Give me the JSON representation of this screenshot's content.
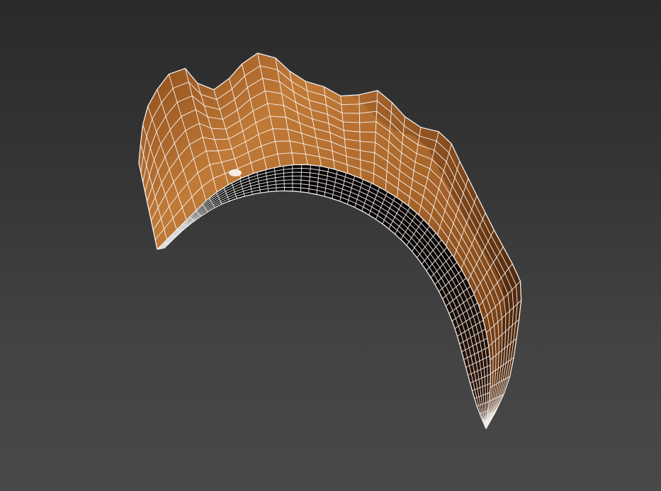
{
  "viewport": {
    "view_mode": "shaded-wireframe",
    "object": "claw-mesh",
    "colors": {
      "background_top": "#2a2a2a",
      "background_bottom": "#494949",
      "surface_light": "#c07a38",
      "surface_mid": "#8a4a18",
      "surface_dark": "#3a1a05",
      "underside": "#0a0604",
      "wire": "#ffffff"
    }
  }
}
